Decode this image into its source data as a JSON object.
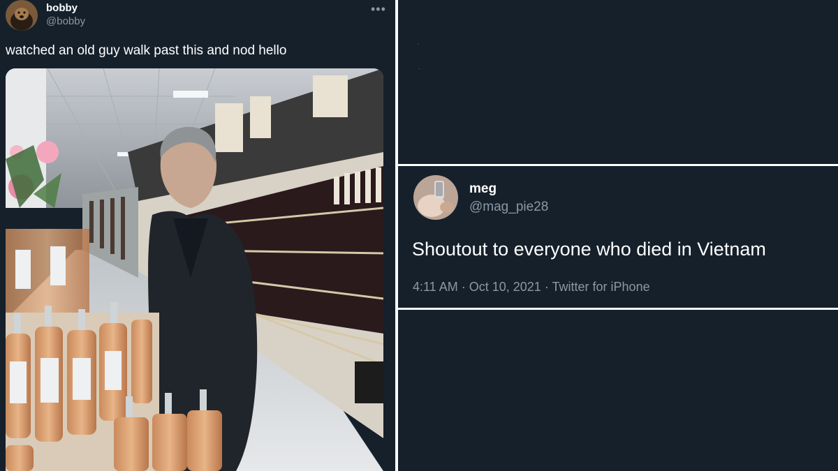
{
  "tweet_bobby": {
    "display_name": "bobby",
    "handle": "@bobby",
    "text": "watched an old guy walk past this and nod hello",
    "more_icon": "more-horizontal-icon"
  },
  "tweet_meg": {
    "display_name": "meg",
    "handle": "@mag_pie28",
    "text": "Shoutout to everyone who died in Vietnam",
    "time": "4:11 AM",
    "date": "Oct 10, 2021",
    "source": "Twitter for iPhone",
    "separator": "·"
  },
  "colors": {
    "background": "#15202b",
    "secondary_text": "#8b98a5",
    "divider": "#ffffff"
  }
}
